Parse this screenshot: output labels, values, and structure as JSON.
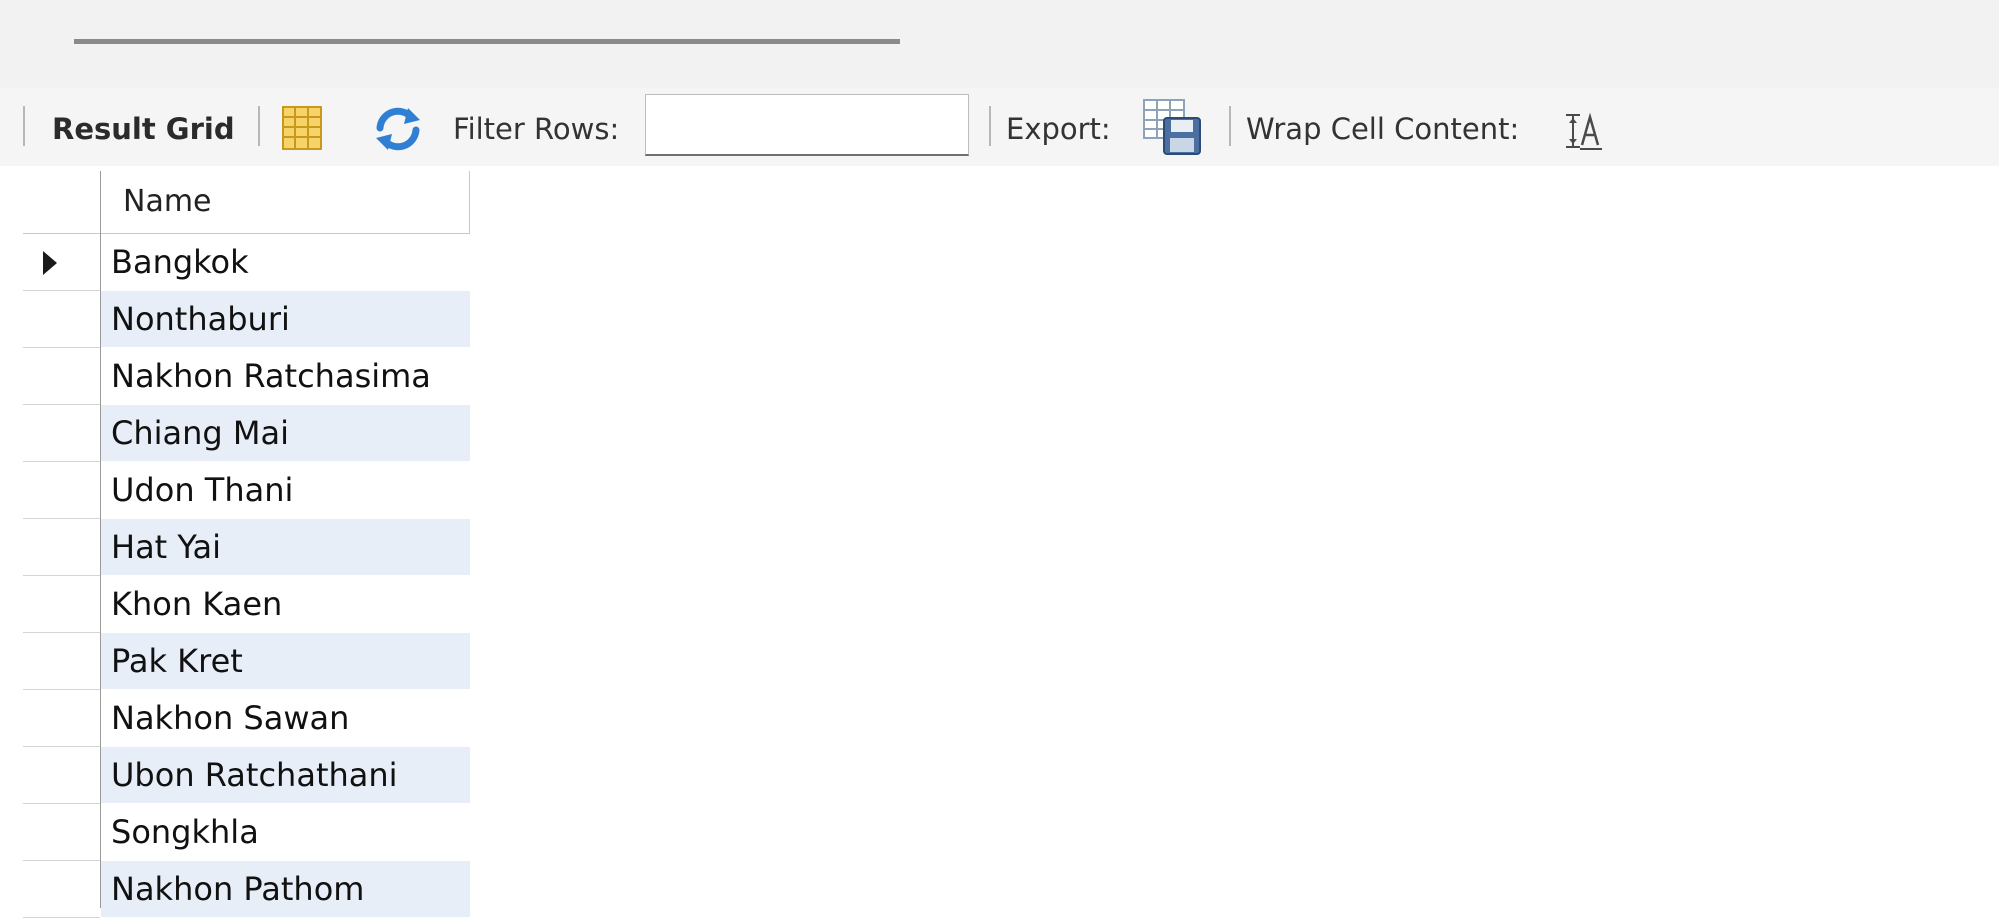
{
  "toolbar": {
    "result_grid_label": "Result Grid",
    "filter_label": "Filter Rows:",
    "filter_value": "",
    "export_label": "Export:",
    "wrap_label": "Wrap Cell Content:",
    "icons": {
      "grid_layout": "grid-layout-icon",
      "refresh": "refresh-icon",
      "export": "export-save-icon",
      "wrap": "wrap-text-icon"
    }
  },
  "grid": {
    "columns": [
      "Name"
    ],
    "rows": [
      "Bangkok",
      "Nonthaburi",
      "Nakhon Ratchasima",
      "Chiang Mai",
      "Udon Thani",
      "Hat Yai",
      "Khon Kaen",
      "Pak Kret",
      "Nakhon Sawan",
      "Ubon Ratchathani",
      "Songkhla",
      "Nakhon Pathom"
    ],
    "selected_row": 0
  },
  "colors": {
    "alt_row": "#e8eef8",
    "toolbar_bg": "#f5f5f5",
    "refresh_blue": "#2f7fd4",
    "grid_yellow": "#f3c443"
  }
}
